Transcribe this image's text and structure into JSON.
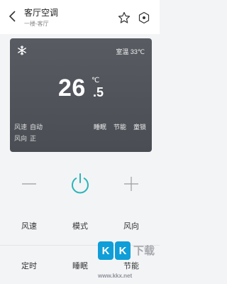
{
  "header": {
    "title": "客厅空调",
    "subtitle": "一楼-客厅"
  },
  "card": {
    "mode_icon": "snowflake-icon",
    "room_temp": "室温 33℃",
    "set_temp_int": "26",
    "set_temp_unit": "℃",
    "set_temp_dec": ".5",
    "fan_speed_label": "风速",
    "fan_speed_value": "自动",
    "fan_dir_label": "风向",
    "fan_dir_value": "正",
    "features": [
      "睡眠",
      "节能",
      "童锁"
    ]
  },
  "controls": {
    "minus_icon": "minus-icon",
    "power_icon": "power-icon",
    "plus_icon": "plus-icon",
    "buttons": [
      "风速",
      "模式",
      "风向",
      "定时",
      "睡眠",
      "节能"
    ],
    "accent_color": "#2bb5b8"
  },
  "watermark": {
    "badge1": "K",
    "badge2": "K",
    "text": "下载",
    "url": "www.kkx.net"
  }
}
